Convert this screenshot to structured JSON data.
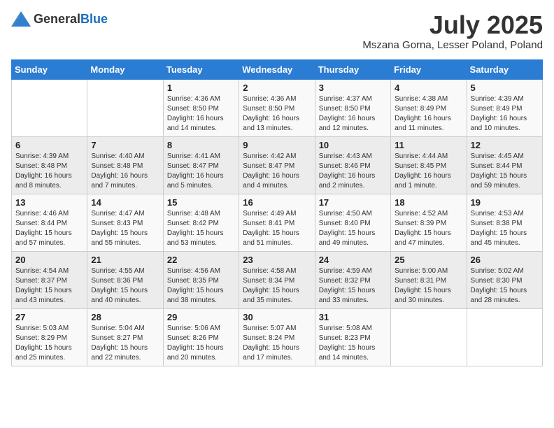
{
  "header": {
    "logo_general": "General",
    "logo_blue": "Blue",
    "month": "July 2025",
    "location": "Mszana Gorna, Lesser Poland, Poland"
  },
  "days_of_week": [
    "Sunday",
    "Monday",
    "Tuesday",
    "Wednesday",
    "Thursday",
    "Friday",
    "Saturday"
  ],
  "weeks": [
    [
      {
        "day": "",
        "sunrise": "",
        "sunset": "",
        "daylight": ""
      },
      {
        "day": "",
        "sunrise": "",
        "sunset": "",
        "daylight": ""
      },
      {
        "day": "1",
        "sunrise": "Sunrise: 4:36 AM",
        "sunset": "Sunset: 8:50 PM",
        "daylight": "Daylight: 16 hours and 14 minutes."
      },
      {
        "day": "2",
        "sunrise": "Sunrise: 4:36 AM",
        "sunset": "Sunset: 8:50 PM",
        "daylight": "Daylight: 16 hours and 13 minutes."
      },
      {
        "day": "3",
        "sunrise": "Sunrise: 4:37 AM",
        "sunset": "Sunset: 8:50 PM",
        "daylight": "Daylight: 16 hours and 12 minutes."
      },
      {
        "day": "4",
        "sunrise": "Sunrise: 4:38 AM",
        "sunset": "Sunset: 8:49 PM",
        "daylight": "Daylight: 16 hours and 11 minutes."
      },
      {
        "day": "5",
        "sunrise": "Sunrise: 4:39 AM",
        "sunset": "Sunset: 8:49 PM",
        "daylight": "Daylight: 16 hours and 10 minutes."
      }
    ],
    [
      {
        "day": "6",
        "sunrise": "Sunrise: 4:39 AM",
        "sunset": "Sunset: 8:48 PM",
        "daylight": "Daylight: 16 hours and 8 minutes."
      },
      {
        "day": "7",
        "sunrise": "Sunrise: 4:40 AM",
        "sunset": "Sunset: 8:48 PM",
        "daylight": "Daylight: 16 hours and 7 minutes."
      },
      {
        "day": "8",
        "sunrise": "Sunrise: 4:41 AM",
        "sunset": "Sunset: 8:47 PM",
        "daylight": "Daylight: 16 hours and 5 minutes."
      },
      {
        "day": "9",
        "sunrise": "Sunrise: 4:42 AM",
        "sunset": "Sunset: 8:47 PM",
        "daylight": "Daylight: 16 hours and 4 minutes."
      },
      {
        "day": "10",
        "sunrise": "Sunrise: 4:43 AM",
        "sunset": "Sunset: 8:46 PM",
        "daylight": "Daylight: 16 hours and 2 minutes."
      },
      {
        "day": "11",
        "sunrise": "Sunrise: 4:44 AM",
        "sunset": "Sunset: 8:45 PM",
        "daylight": "Daylight: 16 hours and 1 minute."
      },
      {
        "day": "12",
        "sunrise": "Sunrise: 4:45 AM",
        "sunset": "Sunset: 8:44 PM",
        "daylight": "Daylight: 15 hours and 59 minutes."
      }
    ],
    [
      {
        "day": "13",
        "sunrise": "Sunrise: 4:46 AM",
        "sunset": "Sunset: 8:44 PM",
        "daylight": "Daylight: 15 hours and 57 minutes."
      },
      {
        "day": "14",
        "sunrise": "Sunrise: 4:47 AM",
        "sunset": "Sunset: 8:43 PM",
        "daylight": "Daylight: 15 hours and 55 minutes."
      },
      {
        "day": "15",
        "sunrise": "Sunrise: 4:48 AM",
        "sunset": "Sunset: 8:42 PM",
        "daylight": "Daylight: 15 hours and 53 minutes."
      },
      {
        "day": "16",
        "sunrise": "Sunrise: 4:49 AM",
        "sunset": "Sunset: 8:41 PM",
        "daylight": "Daylight: 15 hours and 51 minutes."
      },
      {
        "day": "17",
        "sunrise": "Sunrise: 4:50 AM",
        "sunset": "Sunset: 8:40 PM",
        "daylight": "Daylight: 15 hours and 49 minutes."
      },
      {
        "day": "18",
        "sunrise": "Sunrise: 4:52 AM",
        "sunset": "Sunset: 8:39 PM",
        "daylight": "Daylight: 15 hours and 47 minutes."
      },
      {
        "day": "19",
        "sunrise": "Sunrise: 4:53 AM",
        "sunset": "Sunset: 8:38 PM",
        "daylight": "Daylight: 15 hours and 45 minutes."
      }
    ],
    [
      {
        "day": "20",
        "sunrise": "Sunrise: 4:54 AM",
        "sunset": "Sunset: 8:37 PM",
        "daylight": "Daylight: 15 hours and 43 minutes."
      },
      {
        "day": "21",
        "sunrise": "Sunrise: 4:55 AM",
        "sunset": "Sunset: 8:36 PM",
        "daylight": "Daylight: 15 hours and 40 minutes."
      },
      {
        "day": "22",
        "sunrise": "Sunrise: 4:56 AM",
        "sunset": "Sunset: 8:35 PM",
        "daylight": "Daylight: 15 hours and 38 minutes."
      },
      {
        "day": "23",
        "sunrise": "Sunrise: 4:58 AM",
        "sunset": "Sunset: 8:34 PM",
        "daylight": "Daylight: 15 hours and 35 minutes."
      },
      {
        "day": "24",
        "sunrise": "Sunrise: 4:59 AM",
        "sunset": "Sunset: 8:32 PM",
        "daylight": "Daylight: 15 hours and 33 minutes."
      },
      {
        "day": "25",
        "sunrise": "Sunrise: 5:00 AM",
        "sunset": "Sunset: 8:31 PM",
        "daylight": "Daylight: 15 hours and 30 minutes."
      },
      {
        "day": "26",
        "sunrise": "Sunrise: 5:02 AM",
        "sunset": "Sunset: 8:30 PM",
        "daylight": "Daylight: 15 hours and 28 minutes."
      }
    ],
    [
      {
        "day": "27",
        "sunrise": "Sunrise: 5:03 AM",
        "sunset": "Sunset: 8:29 PM",
        "daylight": "Daylight: 15 hours and 25 minutes."
      },
      {
        "day": "28",
        "sunrise": "Sunrise: 5:04 AM",
        "sunset": "Sunset: 8:27 PM",
        "daylight": "Daylight: 15 hours and 22 minutes."
      },
      {
        "day": "29",
        "sunrise": "Sunrise: 5:06 AM",
        "sunset": "Sunset: 8:26 PM",
        "daylight": "Daylight: 15 hours and 20 minutes."
      },
      {
        "day": "30",
        "sunrise": "Sunrise: 5:07 AM",
        "sunset": "Sunset: 8:24 PM",
        "daylight": "Daylight: 15 hours and 17 minutes."
      },
      {
        "day": "31",
        "sunrise": "Sunrise: 5:08 AM",
        "sunset": "Sunset: 8:23 PM",
        "daylight": "Daylight: 15 hours and 14 minutes."
      },
      {
        "day": "",
        "sunrise": "",
        "sunset": "",
        "daylight": ""
      },
      {
        "day": "",
        "sunrise": "",
        "sunset": "",
        "daylight": ""
      }
    ]
  ]
}
